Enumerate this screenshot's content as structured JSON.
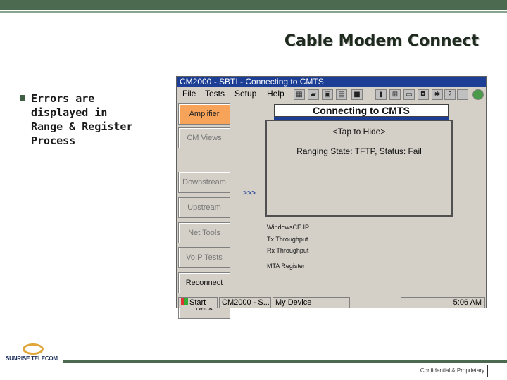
{
  "slide": {
    "title": "Cable Modem Connect",
    "bullet": "Errors are\ndisplayed in\nRange & Register\nProcess"
  },
  "device": {
    "window_title": "CM2000 - SBTI - Connecting to CMTS",
    "menu": [
      "File",
      "Tests",
      "Setup",
      "Help"
    ],
    "nav_buttons": [
      "Amplifier",
      "CM Views",
      "Downstream",
      "Upstream",
      "Net Tools",
      "VoIP Tests",
      "Reconnect",
      "Back"
    ],
    "active_nav": "Amplifier",
    "dialog": {
      "title": "Connecting to CMTS",
      "hide_text": "<Tap to Hide>",
      "message": "Ranging State: TFTP, Status: Fail"
    },
    "arrows": ">>>",
    "status_items": [
      "WindowsCE IP",
      "Tx Throughput",
      "Rx Throughput",
      "MTA Register"
    ],
    "taskbar": {
      "start": "Start",
      "app": "CM2000 - S...",
      "my_device": "My Device",
      "clock": "5:06 AM"
    }
  },
  "footer": {
    "logo_text": "SUNRISE TELECOM",
    "confidential": "Confidential & Proprietary"
  },
  "colors": {
    "brand_green": "#4b6a50",
    "title_blue": "#1c3f95",
    "active_orange": "#f7a35a",
    "logo_gold": "#e1a63a"
  }
}
